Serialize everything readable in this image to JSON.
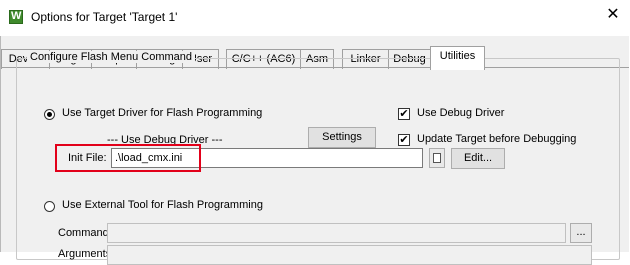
{
  "window": {
    "title": "Options for Target 'Target 1'",
    "close_glyph": "✕",
    "app_icon": "uvision-icon",
    "app_icon_letter": "W"
  },
  "tabs": [
    {
      "label": "Device"
    },
    {
      "label": "Target"
    },
    {
      "label": "Output"
    },
    {
      "label": "Listing"
    },
    {
      "label": "User"
    },
    {
      "label": "C/C++ (AC6)"
    },
    {
      "label": "Asm"
    },
    {
      "label": "Linker"
    },
    {
      "label": "Debug"
    },
    {
      "label": "Utilities",
      "active": true
    }
  ],
  "group": {
    "title": "Configure Flash Menu Command",
    "use_target_driver": {
      "label": "Use Target Driver for Flash Programming",
      "selected": true
    },
    "use_debug_driver_dropdown": "--- Use Debug Driver ---",
    "settings_label": "Settings",
    "use_debug_driver_check": {
      "label": "Use Debug Driver",
      "checked": true
    },
    "update_target_check": {
      "label": "Update Target before Debugging",
      "checked": true
    },
    "init_file": {
      "label": "Init File:",
      "value": ".\\load_cmx.ini"
    },
    "edit_label": "Edit...",
    "use_external_tool": {
      "label": "Use External Tool for Flash Programming",
      "selected": false
    },
    "command_label": "Command:",
    "arguments_label": "Arguments:",
    "ellipsis_label": "..."
  },
  "check_glyph": "✔",
  "highlight_color": "#e2001a"
}
